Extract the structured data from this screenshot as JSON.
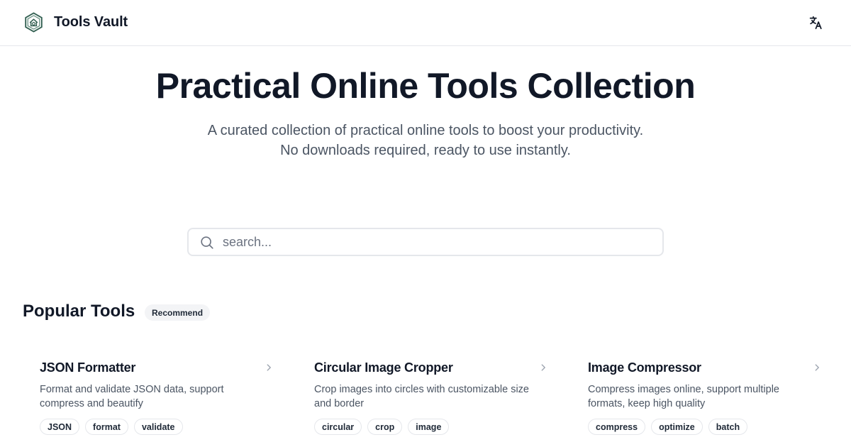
{
  "header": {
    "brand": "Tools Vault",
    "logo_icon": "house-gear-logo-icon",
    "language_icon": "translate-icon"
  },
  "hero": {
    "title": "Practical Online Tools Collection",
    "subtitle_line1": "A curated collection of practical online tools to boost your productivity.",
    "subtitle_line2": "No downloads required, ready to use instantly."
  },
  "search": {
    "placeholder": "search...",
    "value": "",
    "icon": "search-icon"
  },
  "popular": {
    "title": "Popular Tools",
    "badge": "Recommend",
    "cards": [
      {
        "title": "JSON Formatter",
        "description": "Format and validate JSON data, support compress and beautify",
        "tags": [
          "JSON",
          "format",
          "validate"
        ]
      },
      {
        "title": "Circular Image Cropper",
        "description": "Crop images into circles with customizable size and border",
        "tags": [
          "circular",
          "crop",
          "image"
        ]
      },
      {
        "title": "Image Compressor",
        "description": "Compress images online, support multiple formats, keep high quality",
        "tags": [
          "compress",
          "optimize",
          "batch"
        ]
      }
    ]
  },
  "colors": {
    "text_primary": "#111827",
    "text_secondary": "#4b5563",
    "border": "#e5e7eb",
    "logo_green": "#2f5d4f"
  }
}
